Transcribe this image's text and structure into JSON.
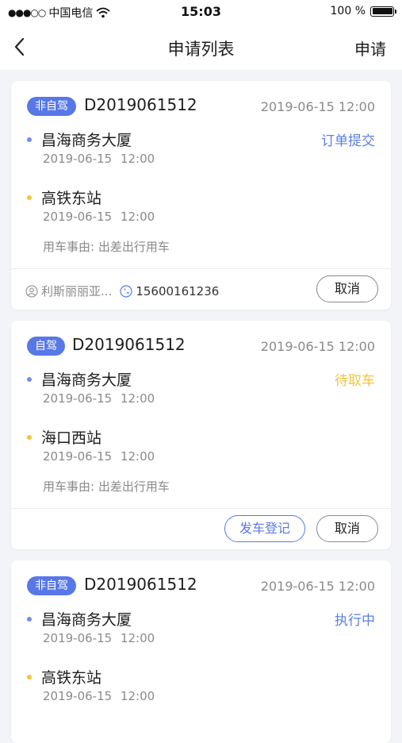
{
  "status_bar": {
    "carrier": "中国电信",
    "signal_dots": "●●●○○",
    "time": "15:03",
    "battery": "100 %",
    "battery_level": 1.0
  },
  "nav": {
    "title": "申请列表",
    "action": "申请"
  },
  "colors": {
    "accent": "#5878e8",
    "status_blue": "#5b7ee5",
    "status_yellow": "#f5c43a",
    "dot_blue": "#6f90e6",
    "dot_yellow": "#f5c43a"
  },
  "orders": [
    {
      "tag": "非自驾",
      "order_no": "D2019061512",
      "time": "2019-06-15 12:00",
      "status": "订单提交",
      "status_color": "blue",
      "from": {
        "name": "昌海商务大厦",
        "time": "2019-06-15  12:00"
      },
      "to": {
        "name": "高铁东站",
        "time": "2019-06-15  12:00"
      },
      "reason": "用车事由: 出差出行用车",
      "contact_name": "利斯丽丽亚...",
      "contact_phone": "15600161236",
      "cancel_label": "取消"
    },
    {
      "tag": "自驾",
      "order_no": "D2019061512",
      "time": "2019-06-15 12:00",
      "status": "待取车",
      "status_color": "yellow",
      "from": {
        "name": "昌海商务大厦",
        "time": "2019-06-15  12:00"
      },
      "to": {
        "name": "海口西站",
        "time": "2019-06-15  12:00"
      },
      "reason": "用车事由: 出差出行用车",
      "register_label": "发车登记",
      "cancel_label": "取消"
    },
    {
      "tag": "非自驾",
      "order_no": "D2019061512",
      "time": "2019-06-15 12:00",
      "status": "执行中",
      "status_color": "blue",
      "from": {
        "name": "昌海商务大厦",
        "time": "2019-06-15  12:00"
      },
      "to": {
        "name": "高铁东站",
        "time": "2019-06-15  12:00"
      }
    }
  ]
}
